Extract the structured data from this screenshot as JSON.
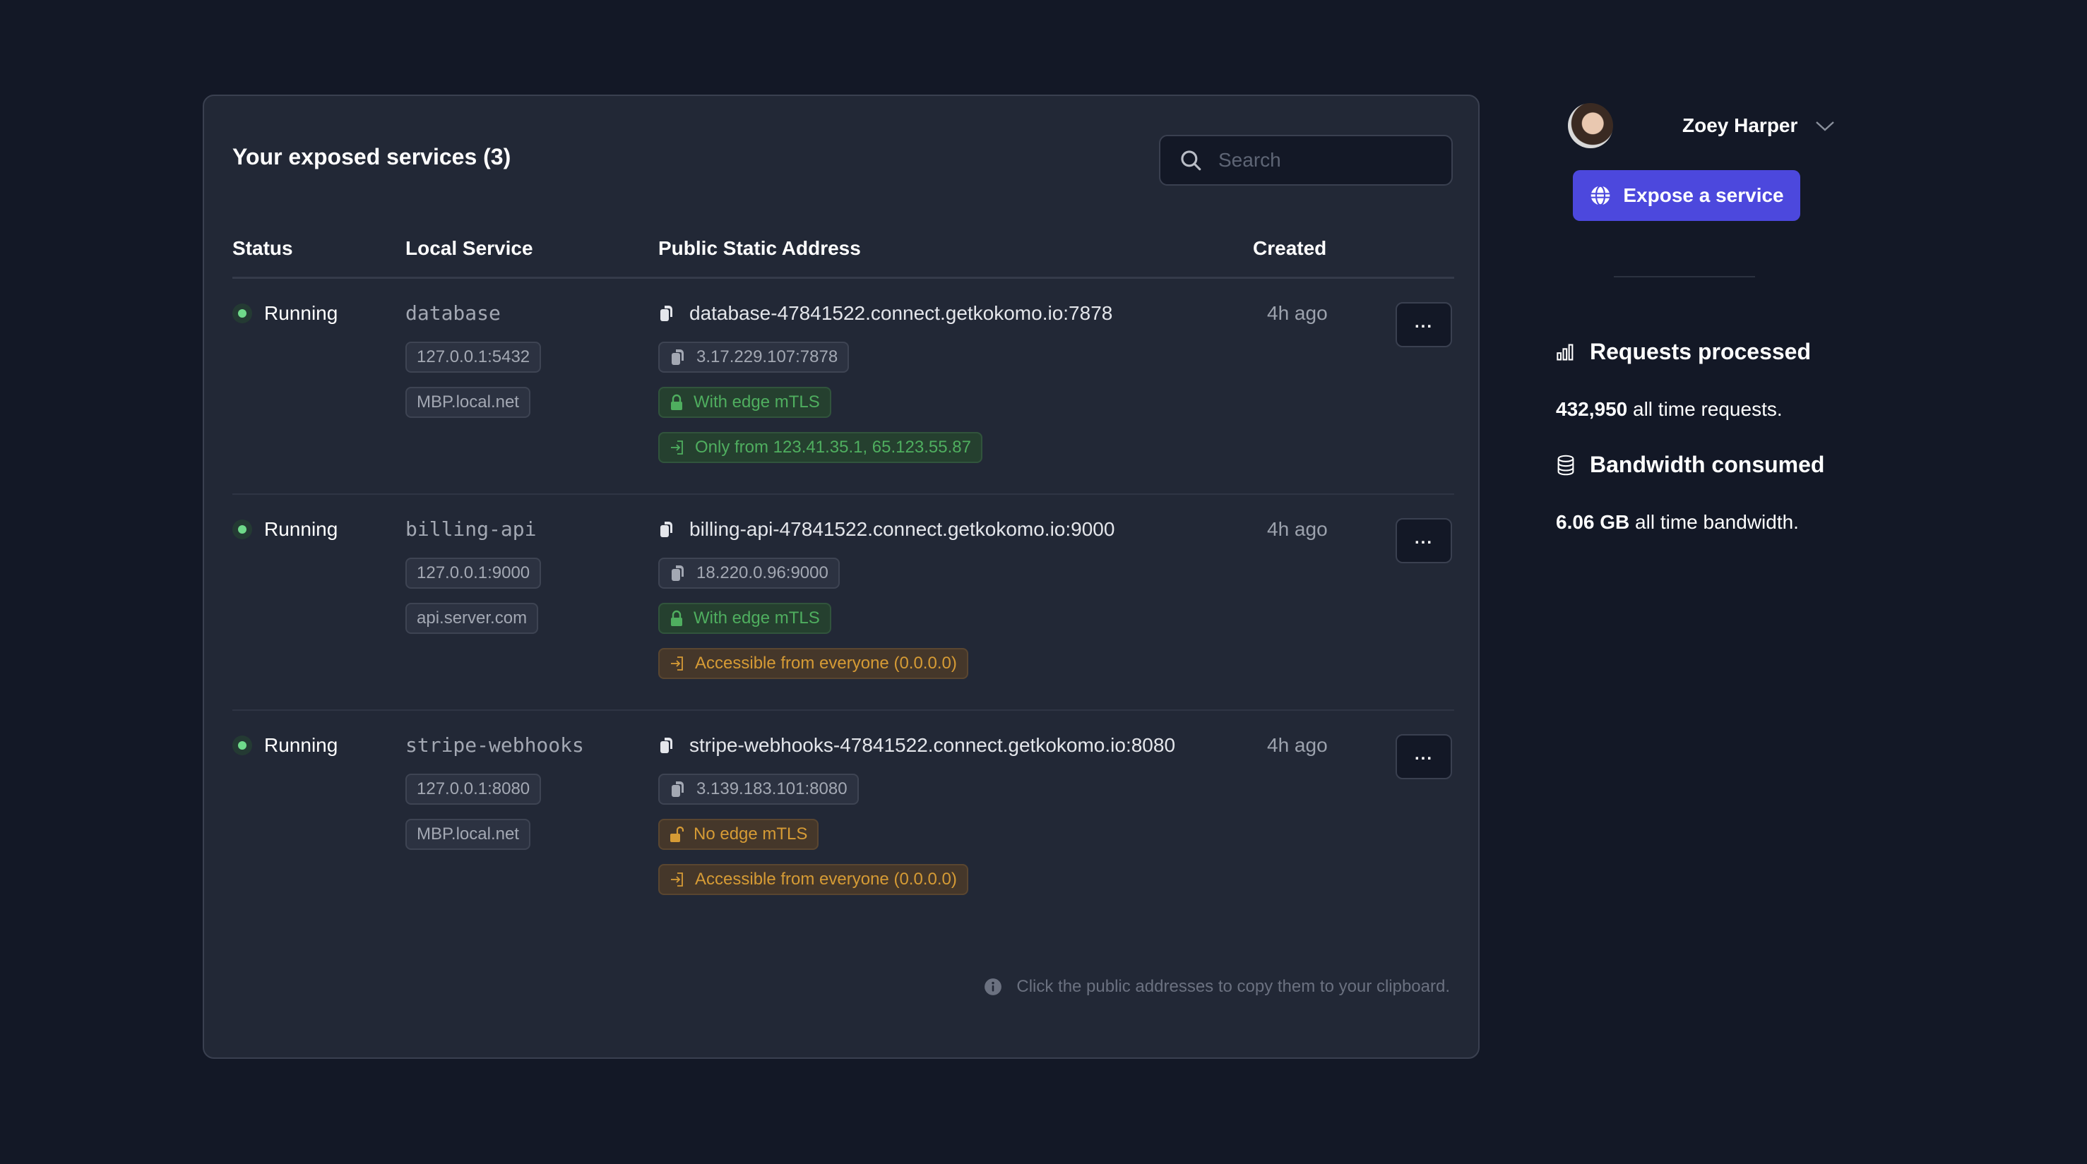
{
  "card": {
    "title": "Your exposed services (3)",
    "search": {
      "placeholder": "Search",
      "value": ""
    },
    "columns": [
      "Status",
      "Local Service",
      "Public Static Address",
      "Created"
    ],
    "rows": [
      {
        "status": "Running",
        "local_name": "database",
        "local_address": "127.0.0.1:5432",
        "local_host": "MBP.local.net",
        "public_address": "database-47841522.connect.getkokomo.io:7878",
        "public_ip": "3.17.229.107:7878",
        "mtls": {
          "label": "With edge mTLS",
          "tone": "green",
          "icon": "lock-icon"
        },
        "access": {
          "label": "Only from 123.41.35.1, 65.123.55.87",
          "tone": "green",
          "icon": "sign-in-icon"
        },
        "created": "4h ago",
        "menu_label": "..."
      },
      {
        "status": "Running",
        "local_name": "billing-api",
        "local_address": "127.0.0.1:9000",
        "local_host": "api.server.com",
        "public_address": "billing-api-47841522.connect.getkokomo.io:9000",
        "public_ip": "18.220.0.96:9000",
        "mtls": {
          "label": "With edge mTLS",
          "tone": "green",
          "icon": "lock-icon"
        },
        "access": {
          "label": "Accessible from everyone (0.0.0.0)",
          "tone": "amber",
          "icon": "sign-in-icon"
        },
        "created": "4h ago",
        "menu_label": "..."
      },
      {
        "status": "Running",
        "local_name": "stripe-webhooks",
        "local_address": "127.0.0.1:8080",
        "local_host": "MBP.local.net",
        "public_address": "stripe-webhooks-47841522.connect.getkokomo.io:8080",
        "public_ip": "3.139.183.101:8080",
        "mtls": {
          "label": "No edge mTLS",
          "tone": "amber",
          "icon": "unlock-icon"
        },
        "access": {
          "label": "Accessible from everyone (0.0.0.0)",
          "tone": "amber",
          "icon": "sign-in-icon"
        },
        "created": "4h ago",
        "menu_label": "..."
      }
    ],
    "footnote": "Click the public addresses to copy them to your clipboard."
  },
  "sidebar": {
    "user_name": "Zoey Harper",
    "expose_button": "Expose a service",
    "requests": {
      "title": "Requests processed",
      "value": "432,950",
      "suffix": " all time requests."
    },
    "bandwidth": {
      "title": "Bandwidth consumed",
      "value": "6.06 GB",
      "suffix": " all time bandwidth."
    }
  },
  "colors": {
    "background": "#131826",
    "card": "#222836",
    "accent": "#4c48dd",
    "status_running": "#6fd98a",
    "green_text": "#4fae5f",
    "amber_text": "#d69b35"
  }
}
